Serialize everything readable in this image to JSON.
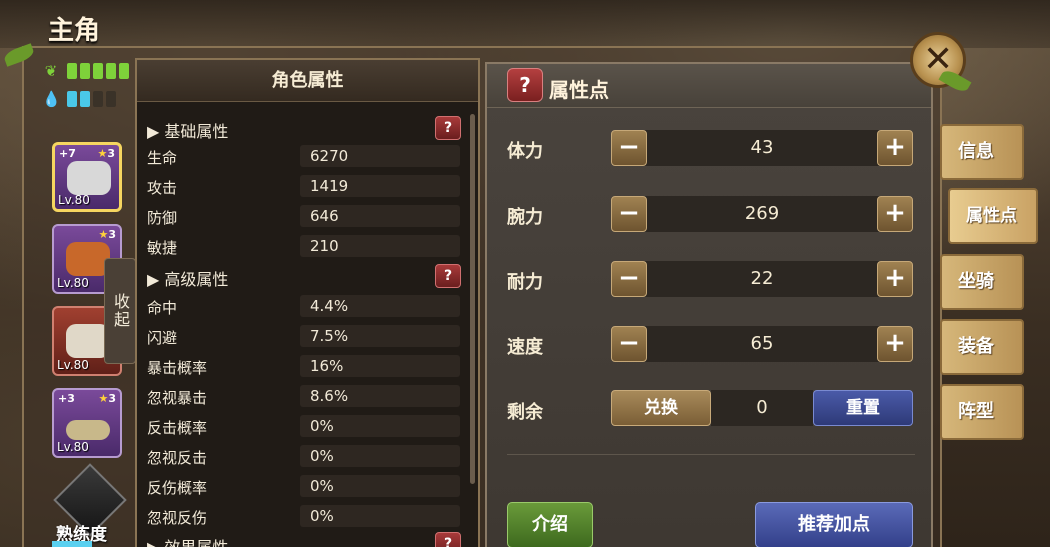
{
  "title": "主角",
  "close_icon": "close-x-icon",
  "stat_bars": {
    "hp_icon": "leaf-icon",
    "mp_icon": "water-drop-icon"
  },
  "equipment": [
    {
      "plus": "+7",
      "stars": "3",
      "level": "Lv.80"
    },
    {
      "plus": "",
      "stars": "3",
      "level": "Lv.80"
    },
    {
      "plus": "",
      "stars": "",
      "level": "Lv.80"
    },
    {
      "plus": "+3",
      "stars": "3",
      "level": "Lv.80"
    }
  ],
  "collapse_label": "收起",
  "mastery_label": "熟练度",
  "attr_panel": {
    "header": "角色属性",
    "basic_title": "▶ 基础属性",
    "advanced_title": "▶ 高级属性",
    "effect_title": "▶ 效果属性",
    "help": "?",
    "basic": [
      {
        "label": "生命",
        "value": "6270"
      },
      {
        "label": "攻击",
        "value": "1419"
      },
      {
        "label": "防御",
        "value": "646"
      },
      {
        "label": "敏捷",
        "value": "210"
      }
    ],
    "advanced": [
      {
        "label": "命中",
        "value": "4.4%"
      },
      {
        "label": "闪避",
        "value": "7.5%"
      },
      {
        "label": "暴击概率",
        "value": "16%"
      },
      {
        "label": "忽视暴击",
        "value": "8.6%"
      },
      {
        "label": "反击概率",
        "value": "0%"
      },
      {
        "label": "忽视反击",
        "value": "0%"
      },
      {
        "label": "反伤概率",
        "value": "0%"
      },
      {
        "label": "忽视反伤",
        "value": "0%"
      }
    ]
  },
  "points_panel": {
    "help": "?",
    "title": "属性点",
    "minus": "−",
    "plus": "+",
    "rows": [
      {
        "label": "体力",
        "value": "43"
      },
      {
        "label": "腕力",
        "value": "269"
      },
      {
        "label": "耐力",
        "value": "22"
      },
      {
        "label": "速度",
        "value": "65"
      }
    ],
    "remain_label": "剩余",
    "remain_value": "0",
    "exchange": "兑换",
    "reset": "重置",
    "intro": "介绍",
    "recommend": "推荐加点"
  },
  "side_tabs": [
    "信息",
    "属性点",
    "坐骑",
    "装备",
    "阵型"
  ],
  "colors": {
    "accent_gold": "#c9a264",
    "help_red": "#a83a3a",
    "reset_blue": "#4a5aa8",
    "intro_green": "#6a9a3a"
  }
}
